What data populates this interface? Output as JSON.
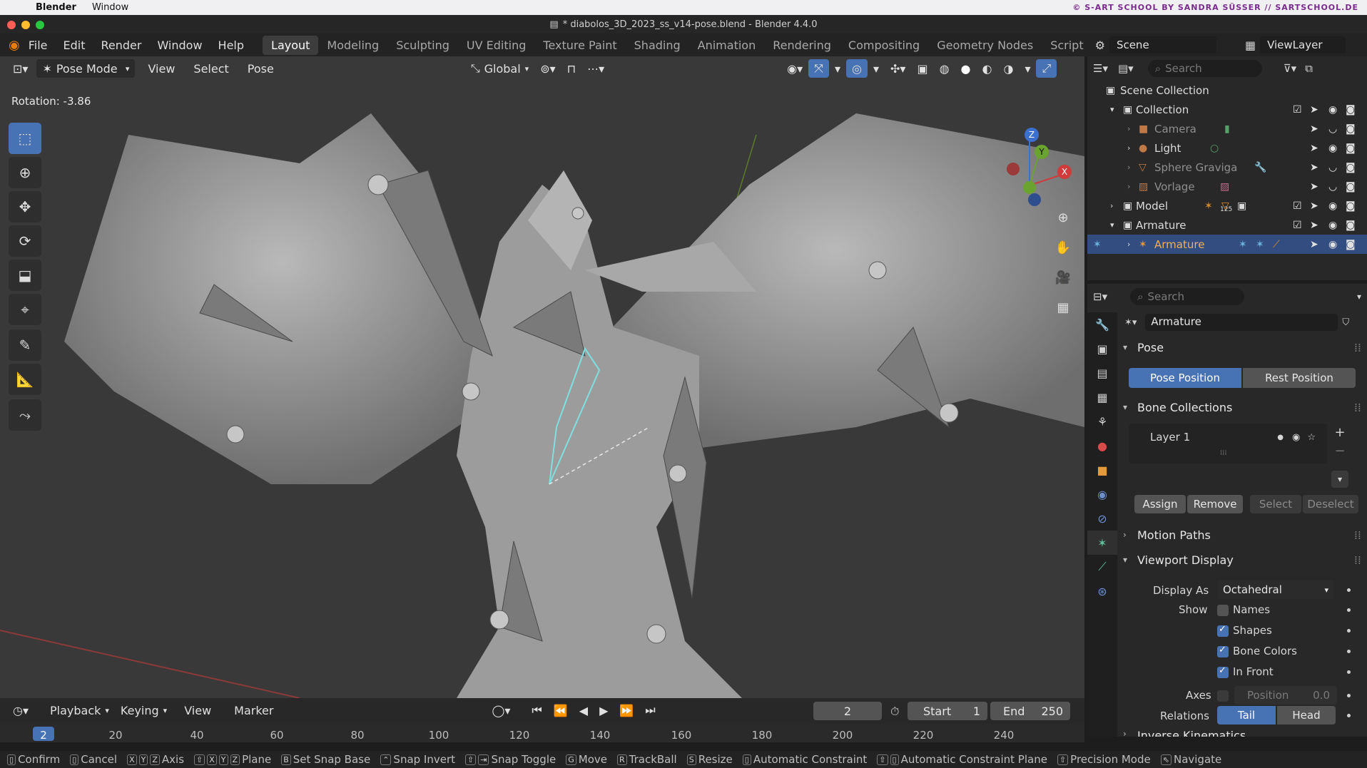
{
  "mac": {
    "menus": [
      "Blender",
      "Window"
    ],
    "brand": "© S-ART SCHOOL BY SANDRA SÜSSER // SARTSCHOOL.DE"
  },
  "window": {
    "title": "* diabolos_3D_2023_ss_v14-pose.blend - Blender 4.4.0"
  },
  "topmenu": {
    "items": [
      "File",
      "Edit",
      "Render",
      "Window",
      "Help"
    ],
    "workspaces": [
      "Layout",
      "Modeling",
      "Sculpting",
      "UV Editing",
      "Texture Paint",
      "Shading",
      "Animation",
      "Rendering",
      "Compositing",
      "Geometry Nodes",
      "Script"
    ],
    "scene": "Scene",
    "viewlayer": "ViewLayer"
  },
  "viewport": {
    "mode": "Pose Mode",
    "menus": [
      "View",
      "Select",
      "Pose"
    ],
    "orientation": "Global",
    "rotation_info": "Rotation: -3.86",
    "gizmo": {
      "z": "Z",
      "y": "Y",
      "x": "X"
    }
  },
  "outliner": {
    "search_placeholder": "Search",
    "rows": [
      {
        "label": "Scene Collection"
      },
      {
        "label": "Collection"
      },
      {
        "label": "Camera"
      },
      {
        "label": "Light"
      },
      {
        "label": "Sphere Graviga"
      },
      {
        "label": "Vorlage"
      },
      {
        "label": "Model",
        "badge": "125"
      },
      {
        "label": "Armature"
      },
      {
        "label": "Armature"
      }
    ]
  },
  "properties": {
    "search_placeholder": "Search",
    "object_name": "Armature",
    "pose": {
      "title": "Pose",
      "pose_position": "Pose Position",
      "rest_position": "Rest Position"
    },
    "bone_collections": {
      "title": "Bone Collections",
      "layer": "Layer 1",
      "assign": "Assign",
      "remove": "Remove",
      "select": "Select",
      "deselect": "Deselect"
    },
    "motion_paths": {
      "title": "Motion Paths"
    },
    "viewport_display": {
      "title": "Viewport Display",
      "display_as_label": "Display As",
      "display_as_value": "Octahedral",
      "show_label": "Show",
      "names": "Names",
      "shapes": "Shapes",
      "bone_colors": "Bone Colors",
      "in_front": "In Front",
      "axes_label": "Axes",
      "position_label": "Position",
      "position_value": "0.0",
      "relations_label": "Relations",
      "tail": "Tail",
      "head": "Head"
    },
    "next_panel": "Inverse Kinematics"
  },
  "timeline": {
    "menus": [
      "Playback",
      "Keying",
      "View",
      "Marker"
    ],
    "current_frame": "2",
    "start_label": "Start",
    "start_value": "1",
    "end_label": "End",
    "end_value": "250",
    "ticks": [
      "2",
      "20",
      "40",
      "60",
      "80",
      "100",
      "120",
      "140",
      "160",
      "180",
      "200",
      "220",
      "240"
    ]
  },
  "statusbar": [
    {
      "keys": "",
      "label": "Confirm"
    },
    {
      "keys": "",
      "label": "Cancel"
    },
    {
      "keys": "X Y Z",
      "label": "Axis"
    },
    {
      "keys": "⇧ X Y Z",
      "label": "Plane"
    },
    {
      "keys": "B",
      "label": "Set Snap Base"
    },
    {
      "keys": "⌃",
      "label": "Snap Invert"
    },
    {
      "keys": "⇧ ⇥",
      "label": "Snap Toggle"
    },
    {
      "keys": "G",
      "label": "Move"
    },
    {
      "keys": "R",
      "label": "TrackBall"
    },
    {
      "keys": "S",
      "label": "Resize"
    },
    {
      "keys": "",
      "label": "Automatic Constraint"
    },
    {
      "keys": "⇧",
      "label": "Automatic Constraint Plane"
    },
    {
      "keys": "⇧",
      "label": "Precision Mode"
    },
    {
      "keys": "",
      "label": "Navigate"
    }
  ],
  "colors": {
    "accent": "#4772b3",
    "selection": "#334d80",
    "bg": "#393939"
  }
}
